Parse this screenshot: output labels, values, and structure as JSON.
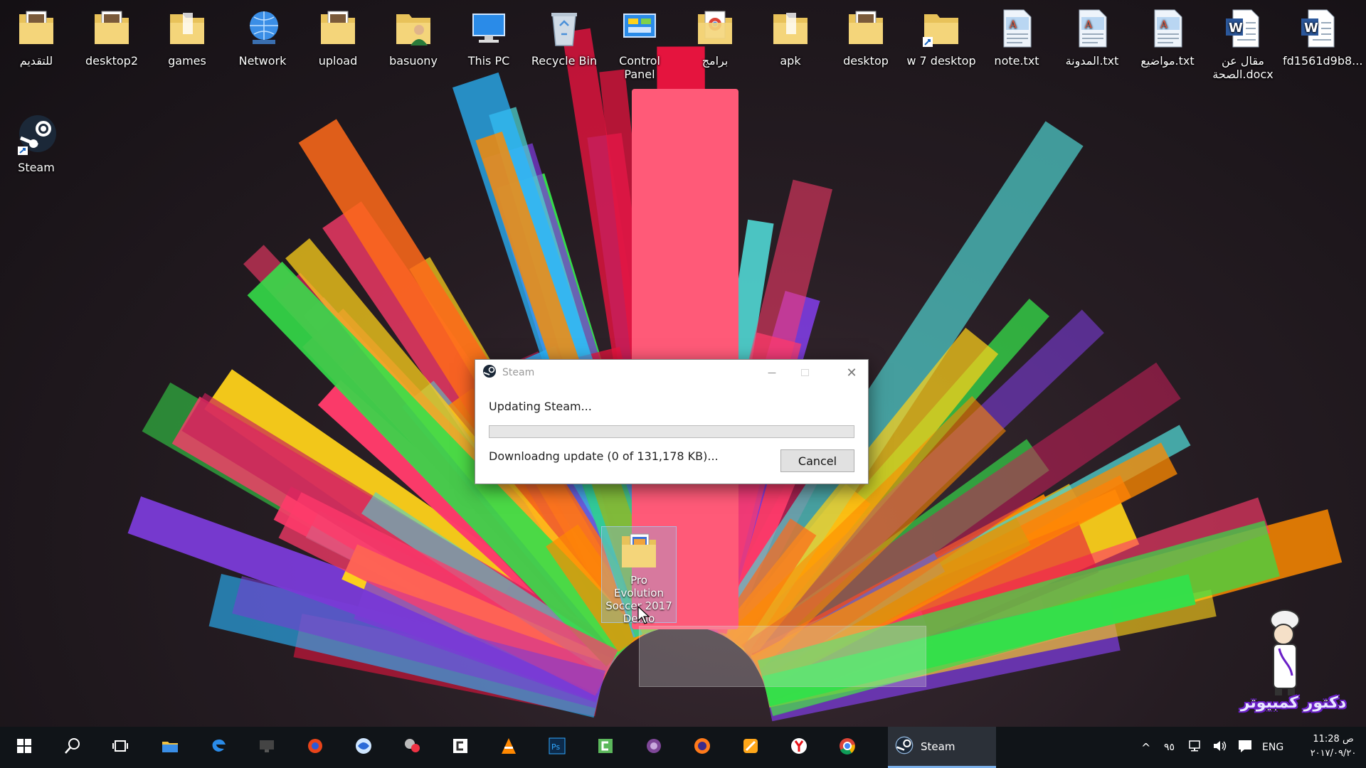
{
  "desktop": {
    "icons_row1": [
      {
        "label": "للتقديم",
        "icon": "folder-photo-icon"
      },
      {
        "label": "desktop2",
        "icon": "folder-photo-icon"
      },
      {
        "label": "games",
        "icon": "folder-icon"
      },
      {
        "label": "Network",
        "icon": "network-globe-icon"
      },
      {
        "label": "upload",
        "icon": "folder-photo-icon"
      },
      {
        "label": "basuony",
        "icon": "user-folder-icon"
      },
      {
        "label": "This PC",
        "icon": "computer-icon"
      },
      {
        "label": "Recycle Bin",
        "icon": "recycle-bin-icon"
      },
      {
        "label": "Control Panel",
        "icon": "control-panel-icon"
      },
      {
        "label": "برامج",
        "icon": "folder-chrome-icon"
      },
      {
        "label": "apk",
        "icon": "folder-icon"
      },
      {
        "label": "desktop",
        "icon": "folder-photo-icon"
      },
      {
        "label": "w 7 desktop",
        "icon": "folder-shortcut-icon"
      },
      {
        "label": "note.txt",
        "icon": "text-file-icon"
      },
      {
        "label": "المدونة.txt",
        "icon": "text-file-icon"
      },
      {
        "label": "مواضيع.txt",
        "icon": "text-file-icon"
      },
      {
        "label": "مقال عن الصحة.docx",
        "icon": "word-document-icon"
      },
      {
        "label": "fd1561d9b8...",
        "icon": "word-document-icon"
      }
    ],
    "steam_shortcut": {
      "label": "Steam",
      "icon": "steam-icon"
    },
    "selected_shortcut": {
      "label": "Pro Evolution Soccer 2017 Demo",
      "icon": "folder-game-icon"
    }
  },
  "dialog": {
    "title": "Steam",
    "status": "Updating Steam...",
    "progress_fraction": 0.0,
    "detail": "Downloadng update (0 of 131,178 KB)...",
    "cancel_label": "Cancel",
    "minimize_glyph": "—",
    "close_glyph": "✕",
    "progress_color": "#06b025"
  },
  "watermark": {
    "text": "دكتور كمبيوتر"
  },
  "taskbar": {
    "pinned": [
      "start-icon",
      "search-icon",
      "task-view-icon",
      "file-explorer-icon",
      "edge-icon",
      "monitor-icon",
      "firefox-alt-icon",
      "browser-icon",
      "tool-icon",
      "camtasia-icon",
      "vlc-icon",
      "photoshop-icon",
      "camtasia-green-icon",
      "tor-icon",
      "firefox-icon",
      "app-icon",
      "yandex-icon",
      "chrome-icon"
    ],
    "steam_label": "Steam",
    "tray": {
      "chevron": "^",
      "language": "ENG",
      "clock_time": "11:28 ص",
      "clock_date": "٢٠١٧/٠٩/٢٠",
      "network_signal_glyph": "٩٥"
    },
    "accent": "#7aaee8"
  }
}
